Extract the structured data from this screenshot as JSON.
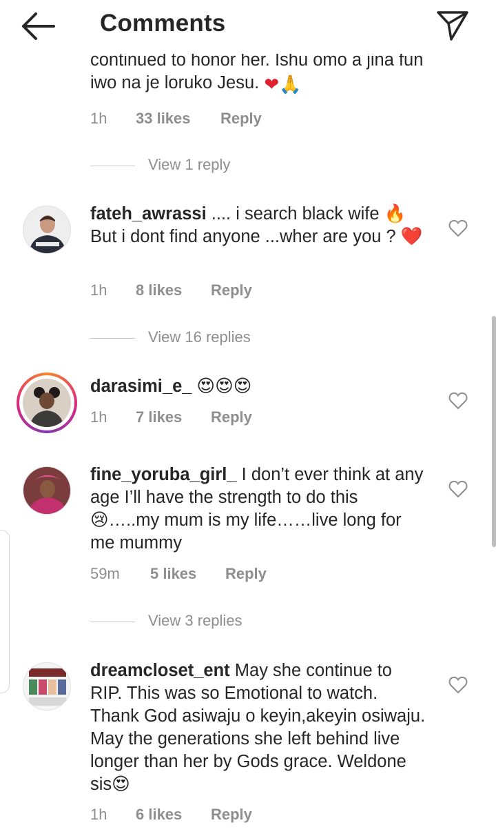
{
  "header": {
    "title": "Comments"
  },
  "top_comment": {
    "text_partial": "continued to honor her. Ishu omo a jina fun iwo na je loruko Jesu. ",
    "time": "1h",
    "likes": "33 likes",
    "reply": "Reply",
    "view_replies": "View 1 reply"
  },
  "comments": [
    {
      "username": "fateh_awrassi",
      "text": ".... i search black wife 🔥 But i dont find anyone ...wher are you ? ❤️",
      "time": "1h",
      "likes": "8 likes",
      "reply": "Reply",
      "view_replies": "View 16 replies"
    },
    {
      "username": "darasimi_e_",
      "text": "😍😍😍",
      "time": "1h",
      "likes": "7 likes",
      "reply": "Reply"
    },
    {
      "username": "fine_yoruba_girl_",
      "text": "I don’t ever think at any age I’ll have the strength to do this 😢…..my mum is my life……live long for me mummy",
      "time": "59m",
      "likes": "5 likes",
      "reply": "Reply",
      "view_replies": "View 3 replies"
    },
    {
      "username": "dreamcloset_ent",
      "text": "May she continue to RIP. This was so Emotional to watch. Thank God asiwaju o keyin,akeyin osiwaju. May the generations she left behind live longer than her by Gods grace. Weldone sis😍",
      "time": "1h",
      "likes": "6 likes",
      "reply": "Reply",
      "avatar_logo_text": "DreamCloset"
    }
  ],
  "icons": {
    "back": "arrow-left-icon",
    "send": "paper-plane-icon",
    "like": "heart-outline-icon"
  },
  "colors": {
    "text": "#262626",
    "meta": "#8e8e8e",
    "heart_red": "#e0212f"
  }
}
